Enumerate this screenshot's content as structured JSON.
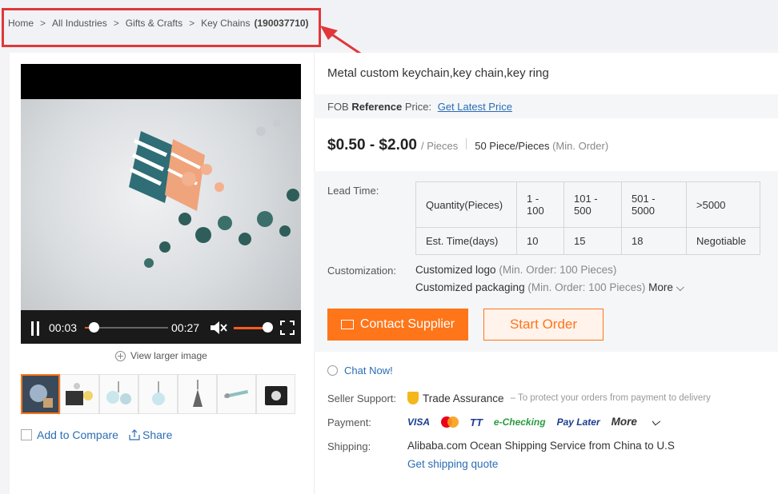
{
  "breadcrumb": {
    "items": [
      "Home",
      "All Industries",
      "Gifts & Crafts",
      "Key Chains"
    ],
    "category_id": "(190037710)",
    "separator": ">"
  },
  "product": {
    "title": "Metal custom keychain,key chain,key ring"
  },
  "video": {
    "current_time": "00:03",
    "total_time": "00:27",
    "progress": 0.11,
    "volume": 0.75
  },
  "gallery": {
    "view_larger": "View larger image",
    "thumbnail_count": 7,
    "active_index": 0
  },
  "actions": {
    "compare": "Add to Compare",
    "share": "Share"
  },
  "fob": {
    "prefix": "FOB",
    "bold": "Reference",
    "suffix": "Price:",
    "link": "Get Latest Price"
  },
  "price": {
    "range": "$0.50 - $2.00",
    "unit": "/ Pieces",
    "moq": "50 Piece/Pieces",
    "moq_note": "(Min. Order)"
  },
  "lead_time": {
    "label": "Lead Time:",
    "row1": [
      "Quantity(Pieces)",
      "1 - 100",
      "101 - 500",
      "501 - 5000",
      ">5000"
    ],
    "row2": [
      "Est. Time(days)",
      "10",
      "15",
      "18",
      "Negotiable"
    ]
  },
  "customization": {
    "label": "Customization:",
    "logo": "Customized logo",
    "logo_note": "(Min. Order: 100 Pieces)",
    "packaging": "Customized packaging",
    "packaging_note": "(Min. Order: 100 Pieces)",
    "more": "More"
  },
  "buttons": {
    "contact": "Contact Supplier",
    "order": "Start Order"
  },
  "chat": "Chat Now!",
  "seller_support": {
    "label": "Seller Support:",
    "name": "Trade Assurance",
    "note": "– To protect your orders from payment to delivery"
  },
  "payment": {
    "label": "Payment:",
    "methods": [
      "VISA",
      "mastercard",
      "TT",
      "e-Checking",
      "Pay Later"
    ],
    "more": "More"
  },
  "shipping": {
    "label": "Shipping:",
    "service": "Alibaba.com Ocean Shipping Service from China to U.S",
    "link": "Get shipping quote"
  },
  "colors": {
    "accent": "#ff7519",
    "link": "#2a6db5",
    "highlight": "#e0383a"
  }
}
